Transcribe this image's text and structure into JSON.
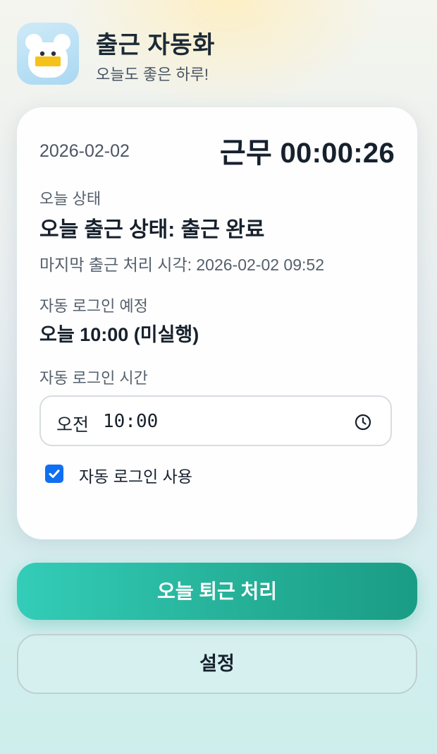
{
  "header": {
    "title": "출근 자동화",
    "subtitle": "오늘도 좋은 하루!",
    "icon": "frog-mascot-icon"
  },
  "card": {
    "date": "2026-02-02",
    "timer": "근무 00:00:26",
    "status_label": "오늘 상태",
    "status_value": "오늘 출근 상태: 출근 완료",
    "last_checkin": "마지막 출근 처리 시각: 2026-02-02 09:52",
    "schedule_label": "자동 로그인 예정",
    "schedule_value": "오늘 10:00 (미실행)",
    "time_label": "자동 로그인 시간",
    "time_input": {
      "ampm": "오전",
      "value": "10:00",
      "icon": "clock-icon"
    },
    "auto_login": {
      "checked": true,
      "label": "자동 로그인 사용"
    }
  },
  "buttons": {
    "checkout": "오늘 퇴근 처리",
    "settings": "설정"
  },
  "colors": {
    "accent": "#27b39b",
    "checkbox": "#0f6ff0",
    "text": "#17212d"
  }
}
